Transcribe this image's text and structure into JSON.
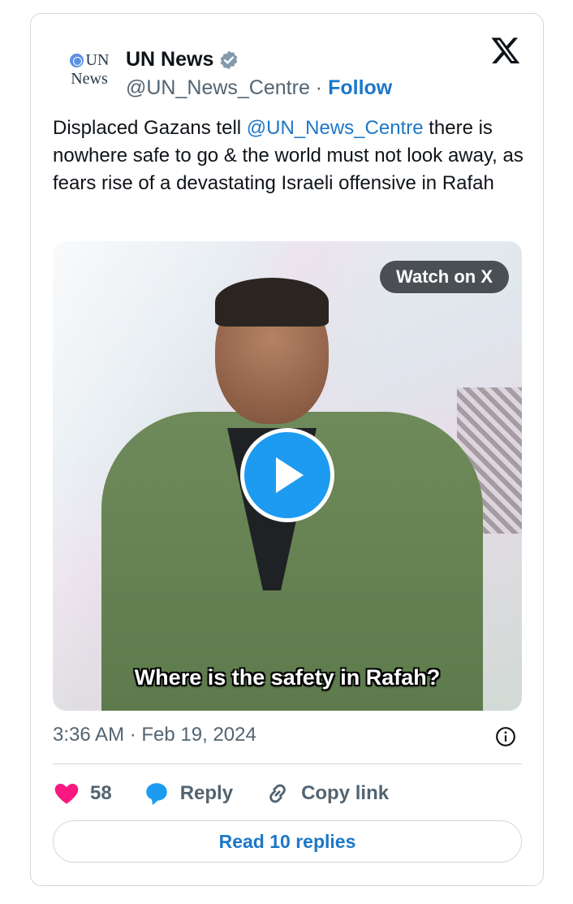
{
  "author": {
    "avatar_line1": "UN",
    "avatar_line2": "News",
    "display_name": "UN News",
    "handle": "@UN_News_Centre",
    "separator": "·",
    "follow_label": "Follow"
  },
  "tweet": {
    "text_before": "Displaced Gazans tell ",
    "mention": "@UN_News_Centre",
    "text_after": " there is nowhere safe to go & the world must not look away, as fears rise of a devastating Israeli offensive in Rafah"
  },
  "media": {
    "watch_label": "Watch on X",
    "caption": "Where is the safety in Rafah?"
  },
  "timestamp": "3:36 AM · Feb 19, 2024",
  "actions": {
    "likes_count": "58",
    "reply_label": "Reply",
    "copy_link_label": "Copy link"
  },
  "read_replies_label": "Read 10 replies",
  "colors": {
    "link_blue": "#1d77c7",
    "play_blue": "#1d9bf0",
    "heart_pink": "#f91880",
    "muted_gray": "#536471"
  },
  "icons": [
    "un-logo-icon",
    "verified-badge-icon",
    "x-logo-icon",
    "play-icon",
    "info-icon",
    "heart-icon",
    "reply-bubble-icon",
    "link-icon"
  ]
}
